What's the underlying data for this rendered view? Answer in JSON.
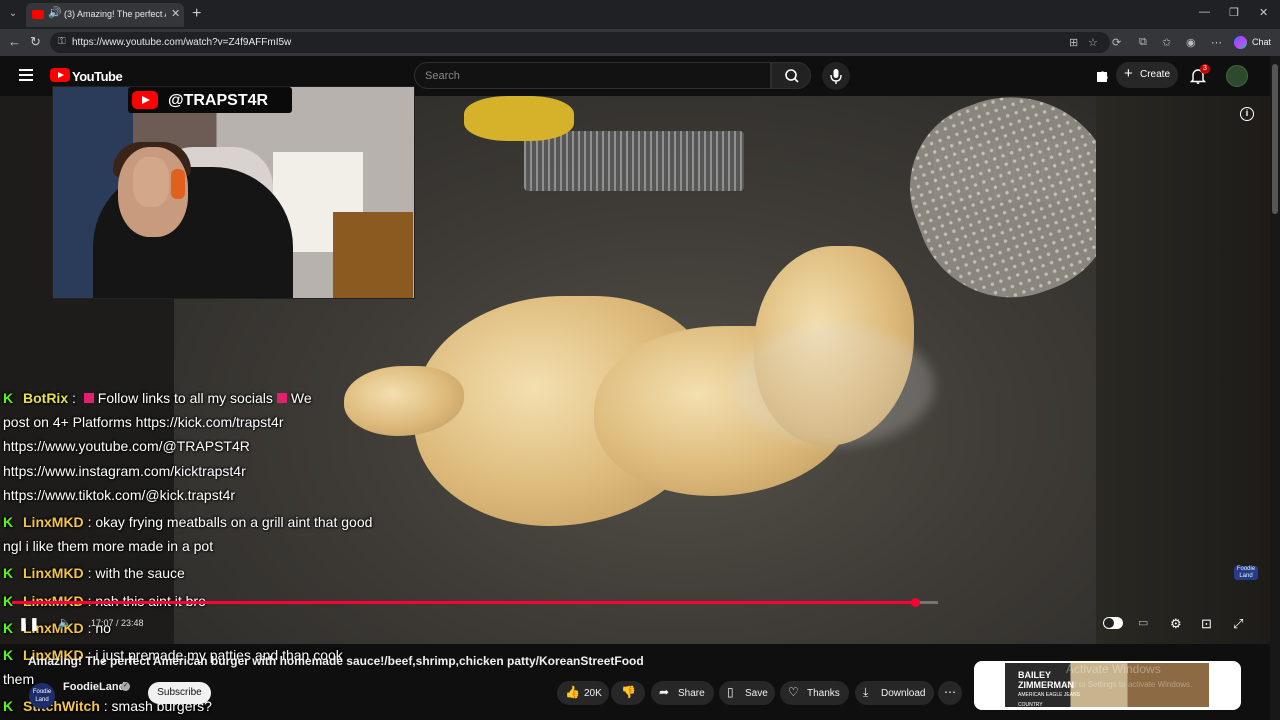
{
  "browser": {
    "tab_title": "(3) Amazing! The perfect Amer",
    "url": "https://www.youtube.com/watch?v=Z4f9AFFmI5w",
    "chat_label": "Chat"
  },
  "youtube": {
    "logo_text": "YouTube",
    "search_placeholder": "Search",
    "create_label": "Create",
    "notification_count": "3"
  },
  "overlay": {
    "handle": "@TRAPST4R"
  },
  "chat": {
    "bot_name": "BotRix",
    "bot_message_start": "Follow links to all my socials",
    "bot_message_cont": "We",
    "bot_line2": "post on 4+ Platforms https://kick.com/trapst4r",
    "bot_line3": "https://www.youtube.com/@TRAPST4R",
    "bot_line4": "https://www.instagram.com/kicktrapst4r",
    "bot_line5": "https://www.tiktok.com/@kick.trapst4r",
    "messages": [
      {
        "user": "LinxMKD",
        "text": ": okay frying meatballs on a grill aint that good"
      },
      {
        "cont": "ngl i like them more made in a pot"
      },
      {
        "user": "LinxMKD",
        "text": ": with the sauce"
      },
      {
        "user": "LinxMKD",
        "text": ": nah this aint it bro"
      },
      {
        "user": "LinxMKD",
        "text": ": no"
      },
      {
        "user": "LinxMKD",
        "text": ": i just premade my patties and than cook"
      },
      {
        "cont": "them"
      },
      {
        "user": "StitchWitch",
        "text": ": smash burgers?"
      }
    ]
  },
  "player": {
    "time": "17:07 / 23:48",
    "progress_fraction": 0.735
  },
  "video": {
    "title": "Amazing! The perfect American burger with homemade sauce!/beef,shrimp,chicken patty/KoreanStreetFood",
    "channel": "FoodieLand",
    "channel_avatar_text": "Foodie Land",
    "subscriber_text": "",
    "subscribe_label": "Subscribe",
    "likes": "20K",
    "share_label": "Share",
    "save_label": "Save",
    "thanks_label": "Thanks",
    "download_label": "Download",
    "corner_logo": "Foodie Land"
  },
  "ad": {
    "brand": "BAILEY ZIMMERMAN",
    "sub": "AMERICAN EAGLE JEANS COUNTRY"
  },
  "watermark": {
    "line1": "Activate Windows",
    "line2": "Go to Settings to activate Windows."
  }
}
